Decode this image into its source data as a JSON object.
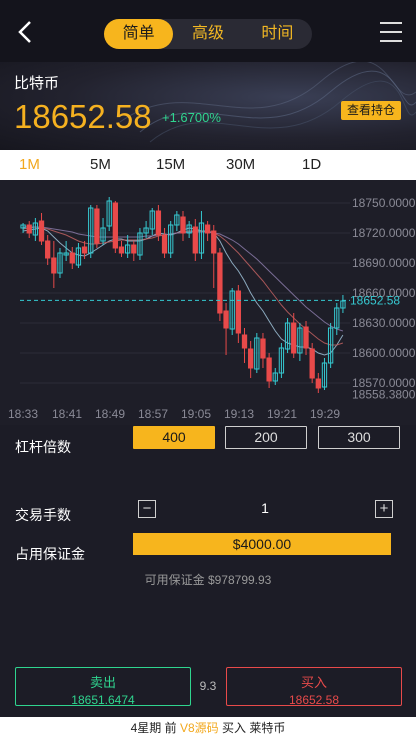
{
  "header": {
    "tabs": [
      "简单",
      "高级",
      "时间"
    ],
    "active_tab": 0
  },
  "hero": {
    "coin_name": "比特币",
    "price": "18652.58",
    "change": "+1.6700%",
    "hold_button": "查看持仓"
  },
  "periods": [
    "1M",
    "5M",
    "15M",
    "30M",
    "1D"
  ],
  "active_period": 0,
  "chart_data": {
    "type": "candlestick",
    "x_tick_labels": [
      "18:33",
      "18:41",
      "18:49",
      "18:57",
      "19:05",
      "19:13",
      "19:21",
      "19:29"
    ],
    "y_tick_labels": [
      "18750.0000",
      "18720.0000",
      "18690.0000",
      "18660.0000",
      "18630.0000",
      "18600.0000",
      "18570.0000",
      "18558.3800"
    ],
    "ylim": [
      18558.38,
      18750
    ],
    "current_price_label": "18652.58",
    "current_price": 18652.58,
    "candles": [
      [
        18725,
        18728,
        18730,
        18720
      ],
      [
        18728,
        18720,
        18732,
        18715
      ],
      [
        18718,
        18730,
        18735,
        18712
      ],
      [
        18732,
        18712,
        18740,
        18708
      ],
      [
        18712,
        18695,
        18718,
        18688
      ],
      [
        18695,
        18680,
        18712,
        18665
      ],
      [
        18680,
        18700,
        18705,
        18675
      ],
      [
        18698,
        18700,
        18712,
        18692
      ],
      [
        18700,
        18690,
        18706,
        18684
      ],
      [
        18688,
        18705,
        18710,
        18685
      ],
      [
        18706,
        18700,
        18712,
        18694
      ],
      [
        18700,
        18745,
        18748,
        18695
      ],
      [
        18744,
        18710,
        18748,
        18705
      ],
      [
        18712,
        18725,
        18735,
        18708
      ],
      [
        18727,
        18752,
        18756,
        18722
      ],
      [
        18750,
        18705,
        18752,
        18700
      ],
      [
        18706,
        18700,
        18712,
        18696
      ],
      [
        18700,
        18708,
        18718,
        18695
      ],
      [
        18708,
        18700,
        18712,
        18692
      ],
      [
        18698,
        18720,
        18725,
        18693
      ],
      [
        18720,
        18725,
        18732,
        18715
      ],
      [
        18724,
        18742,
        18745,
        18718
      ],
      [
        18742,
        18718,
        18748,
        18712
      ],
      [
        18718,
        18700,
        18725,
        18695
      ],
      [
        18700,
        18728,
        18732,
        18695
      ],
      [
        18728,
        18738,
        18742,
        18722
      ],
      [
        18736,
        18720,
        18742,
        18712
      ],
      [
        18720,
        18728,
        18732,
        18715
      ],
      [
        18726,
        18700,
        18734,
        18692
      ],
      [
        18700,
        18730,
        18742,
        18694
      ],
      [
        18728,
        18720,
        18732,
        18712
      ],
      [
        18722,
        18700,
        18728,
        18665
      ],
      [
        18700,
        18640,
        18705,
        18632
      ],
      [
        18642,
        18625,
        18650,
        18598
      ],
      [
        18624,
        18662,
        18665,
        18618
      ],
      [
        18662,
        18620,
        18668,
        18610
      ],
      [
        18618,
        18605,
        18625,
        18590
      ],
      [
        18604,
        18585,
        18612,
        18575
      ],
      [
        18584,
        18615,
        18620,
        18580
      ],
      [
        18614,
        18595,
        18620,
        18585
      ],
      [
        18595,
        18572,
        18600,
        18565
      ],
      [
        18572,
        18580,
        18585,
        18568
      ],
      [
        18580,
        18605,
        18610,
        18575
      ],
      [
        18604,
        18630,
        18635,
        18600
      ],
      [
        18630,
        18600,
        18640,
        18595
      ],
      [
        18600,
        18625,
        18630,
        18592
      ],
      [
        18626,
        18605,
        18632,
        18598
      ],
      [
        18604,
        18575,
        18610,
        18570
      ],
      [
        18574,
        18565,
        18580,
        18560
      ],
      [
        18566,
        18590,
        18595,
        18563
      ],
      [
        18590,
        18625,
        18630,
        18585
      ],
      [
        18625,
        18645,
        18650,
        18618
      ],
      [
        18645,
        18652,
        18658,
        18640
      ]
    ],
    "ma_lines": [
      {
        "color": "#9fc2d8",
        "values": [
          18722,
          18723,
          18724,
          18725,
          18722,
          18716,
          18710,
          18705,
          18700,
          18698,
          18697,
          18700,
          18704,
          18708,
          18712,
          18714,
          18714,
          18712,
          18712,
          18712,
          18714,
          18717,
          18720,
          18719,
          18718,
          18720,
          18723,
          18725,
          18724,
          18722,
          18722,
          18720,
          18712,
          18700,
          18690,
          18682,
          18672,
          18660,
          18650,
          18642,
          18632,
          18622,
          18614,
          18610,
          18608,
          18606,
          18606,
          18604,
          18600,
          18598,
          18600,
          18608,
          18618
        ]
      },
      {
        "color": "#c06060",
        "values": [
          18724,
          18725,
          18726,
          18725,
          18724,
          18722,
          18720,
          18718,
          18715,
          18712,
          18710,
          18709,
          18709,
          18710,
          18711,
          18712,
          18713,
          18713,
          18713,
          18713,
          18714,
          18715,
          18717,
          18718,
          18719,
          18720,
          18721,
          18722,
          18722,
          18722,
          18721,
          18720,
          18717,
          18712,
          18706,
          18700,
          18693,
          18686,
          18679,
          18672,
          18664,
          18656,
          18648,
          18641,
          18635,
          18629,
          18624,
          18619,
          18614,
          18610,
          18608,
          18608,
          18610
        ]
      },
      {
        "color": "#8a7aa8",
        "values": [
          18726,
          18726,
          18726,
          18726,
          18725,
          18724,
          18723,
          18722,
          18721,
          18719,
          18718,
          18717,
          18716,
          18716,
          18716,
          18716,
          18716,
          18716,
          18716,
          18716,
          18717,
          18717,
          18718,
          18718,
          18719,
          18720,
          18720,
          18721,
          18721,
          18721,
          18721,
          18720,
          18719,
          18716,
          18713,
          18709,
          18704,
          18699,
          18694,
          18688,
          18682,
          18676,
          18670,
          18664,
          18658,
          18652,
          18646,
          18641,
          18636,
          18631,
          18627,
          18624,
          18622
        ]
      }
    ]
  },
  "controls": {
    "leverage_label": "杠杆倍数",
    "leverage_options": [
      "400",
      "200",
      "300"
    ],
    "active_leverage": 0,
    "lots_label": "交易手数",
    "lots_minus": "−",
    "lots_plus": "+",
    "lots_value": "1",
    "margin_label": "占用保证金",
    "margin_value": "$4000.00",
    "available": "可用保证金 $978799.93"
  },
  "trade": {
    "sell_label": "卖出",
    "sell_price": "18651.6474",
    "spread": "9.3",
    "buy_label": "买入",
    "buy_price": "18652.58"
  },
  "ticker": {
    "prefix": "4星期 前",
    "highlight": "V8源码",
    "suffix": "买入 莱特币"
  },
  "colors": {
    "accent": "#f7b51d",
    "up": "#2fd58f",
    "down": "#e84a4a",
    "current_line": "#36c9d1"
  }
}
